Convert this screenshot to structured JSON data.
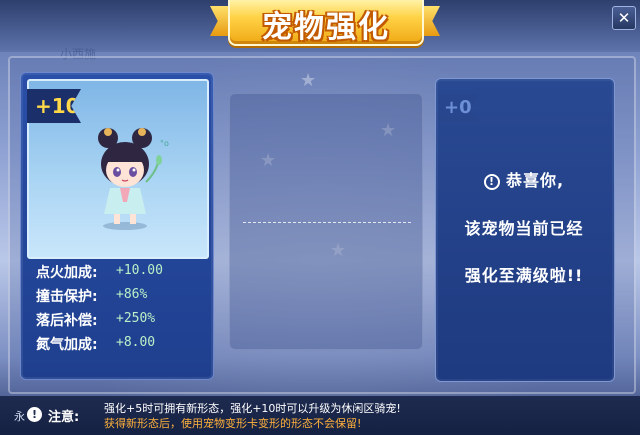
{
  "window": {
    "title": "宠物强化",
    "close_label": "✕",
    "faded_tab_label": "小西施"
  },
  "left_panel": {
    "level_badge": "+10",
    "pet_icon": "chibi-girl-pet",
    "stats": [
      {
        "label": "点火加成:",
        "value": "+10.00"
      },
      {
        "label": "撞击保护:",
        "value": "+86%"
      },
      {
        "label": "落后补偿:",
        "value": "+250%"
      },
      {
        "label": "氮气加成:",
        "value": "+8.00"
      }
    ]
  },
  "right_panel": {
    "level_badge": "+0",
    "info_icon": "!",
    "message_line1": "恭喜你,",
    "message_line2": "该宠物当前已经",
    "message_line3": "强化至满级啦!!"
  },
  "footer": {
    "side_label": "永",
    "notice_label": "注意:",
    "notice_line1": "强化+5时可拥有新形态，强化+10时可以升级为休闲区骑宠!",
    "notice_line2": "获得新形态后，使用宠物变形卡变形的形态不会保留!",
    "notice_line2_color": "#ffb13b"
  },
  "colors": {
    "title_gold": "#ffd245",
    "panel_blue": "#1f3f8e",
    "stat_value_green": "#b9f0c8"
  }
}
